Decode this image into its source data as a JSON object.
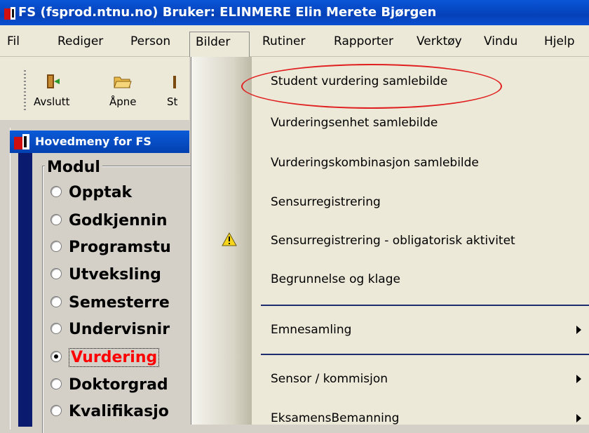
{
  "window": {
    "title": "FS (fsprod.ntnu.no) Bruker: ELINMERE Elin Merete Bjørgen"
  },
  "menubar": {
    "items": [
      {
        "label": "Fil"
      },
      {
        "label": "Rediger"
      },
      {
        "label": "Person"
      },
      {
        "label": "Bilder"
      },
      {
        "label": "Rutiner"
      },
      {
        "label": "Rapporter"
      },
      {
        "label": "Verktøy"
      },
      {
        "label": "Vindu"
      },
      {
        "label": "Hjelp"
      }
    ]
  },
  "toolbar": {
    "buttons": [
      {
        "label": "Avslutt",
        "icon": "exit-door-icon"
      },
      {
        "label": "Åpne",
        "icon": "open-folder-icon"
      },
      {
        "label": "St",
        "icon": "partial-icon"
      }
    ]
  },
  "inner_window": {
    "title": "Hovedmeny for FS",
    "module_group": {
      "legend": "Modul",
      "options": [
        {
          "label": "Opptak",
          "checked": false
        },
        {
          "label": "Godkjennin",
          "checked": false
        },
        {
          "label": "Programstu",
          "checked": false
        },
        {
          "label": "Utveksling",
          "checked": false
        },
        {
          "label": "Semesterre",
          "checked": false
        },
        {
          "label": "Undervisnir",
          "checked": false
        },
        {
          "label": "Vurdering",
          "checked": true
        },
        {
          "label": "Doktorgrad",
          "checked": false
        },
        {
          "label": "Kvalifikasjo",
          "checked": false
        }
      ]
    }
  },
  "dropdown": {
    "items": [
      {
        "label": "Student vurdering samlebilde",
        "highlighted": true
      },
      {
        "label": "Vurderingsenhet samlebilde"
      },
      {
        "label": "Vurderingskombinasjon samlebilde"
      },
      {
        "label": "Sensurregistrering"
      },
      {
        "label": "Sensurregistrering - obligatorisk aktivitet",
        "icon": "warning-icon"
      },
      {
        "label": "Begrunnelse og klage"
      },
      {
        "label": "Emnesamling",
        "submenu": true
      },
      {
        "label": "Sensor / kommisjon",
        "submenu": true
      },
      {
        "label": "EksamensBemanning",
        "submenu": true
      }
    ]
  },
  "colors": {
    "titlebar": "#0541b8",
    "annotation_ellipse": "#e02020",
    "selected_module": "#ff0000"
  }
}
